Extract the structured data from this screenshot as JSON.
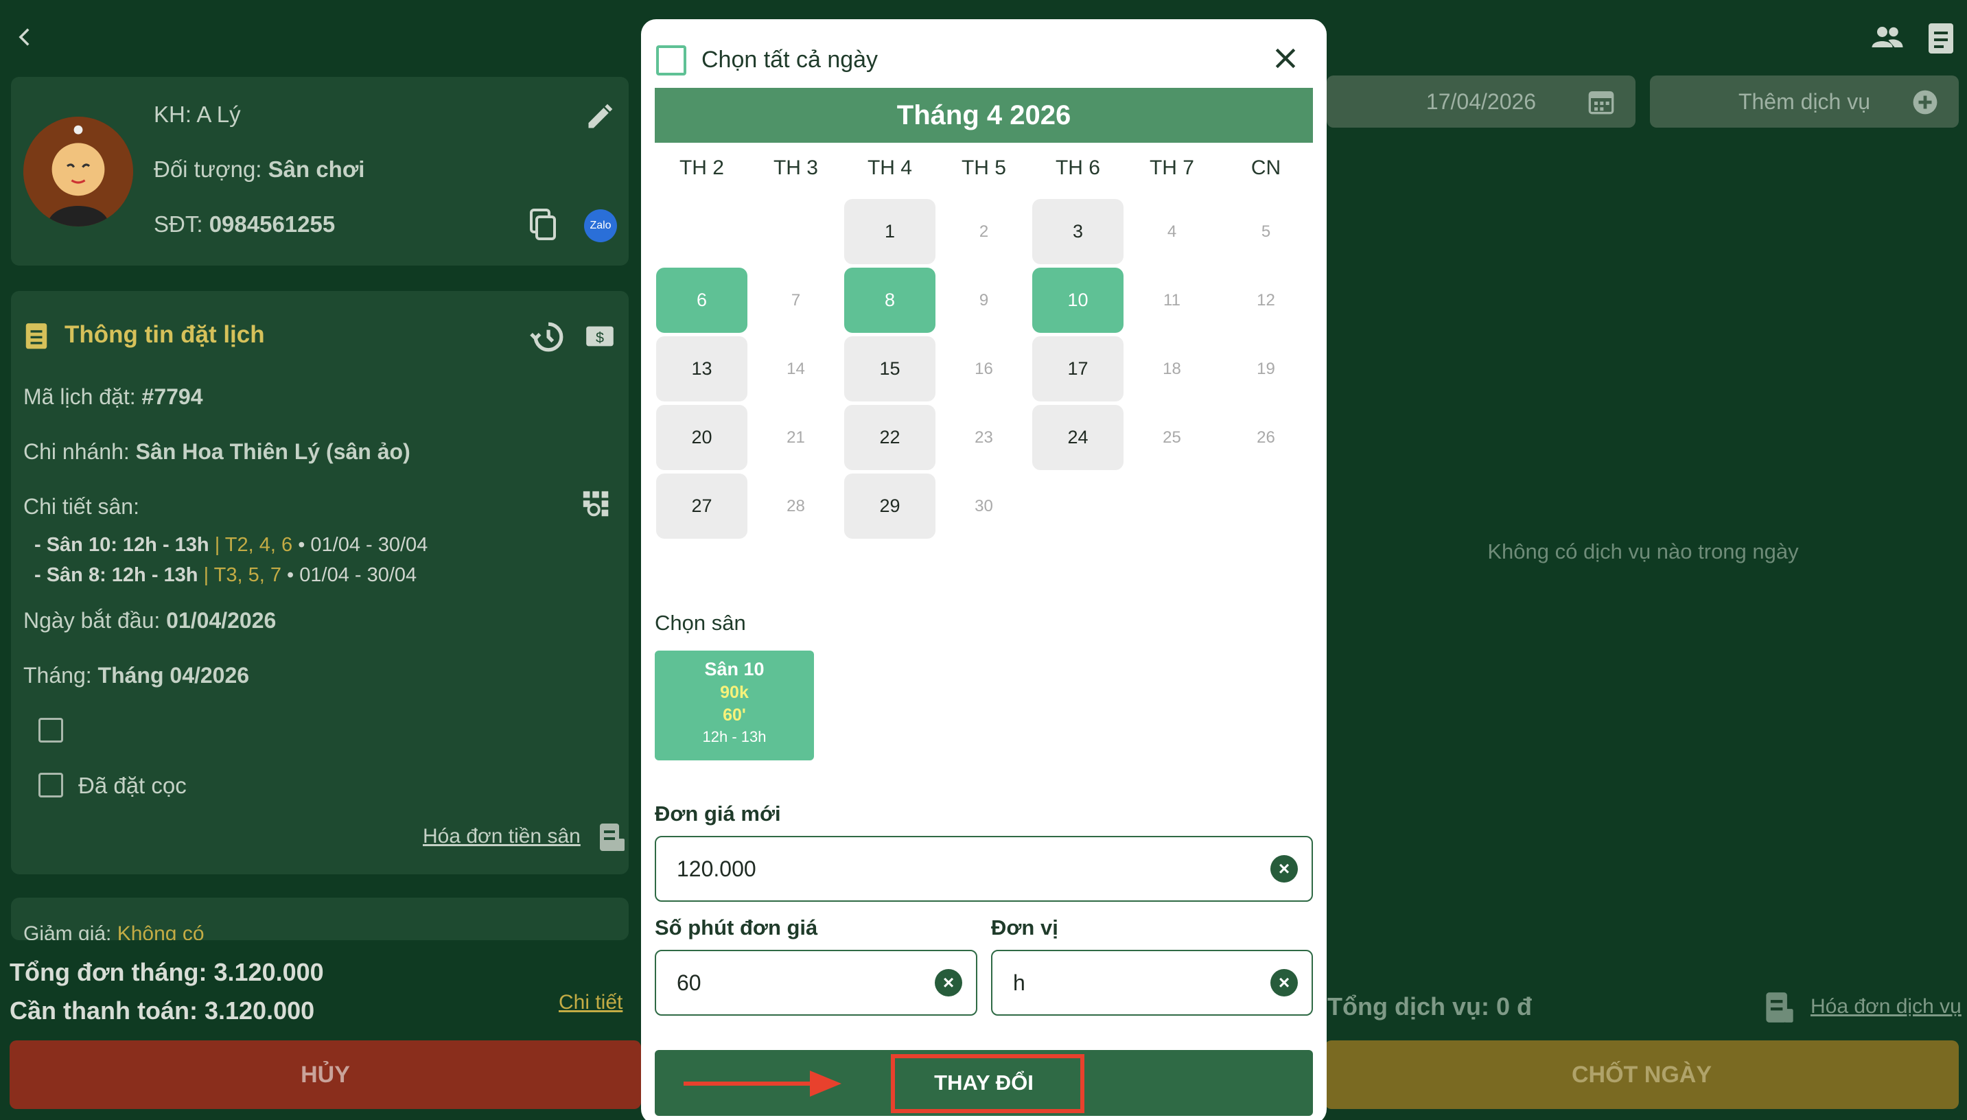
{
  "header": {
    "back_icon": "chevron-left-icon",
    "users_icon": "users-icon",
    "notes_icon": "clipboard-icon"
  },
  "customer": {
    "name_label": "KH:",
    "name_value": "A Lý",
    "target_label": "Đối tượng:",
    "target_value": "Sân chơi",
    "phone_label": "SĐT:",
    "phone_value": "0984561255",
    "zalo_label": "Zalo"
  },
  "booking": {
    "title": "Thông tin đặt lịch",
    "code_label": "Mã lịch đặt:",
    "code_value": "#7794",
    "branch_label": "Chi nhánh:",
    "branch_value": "Sân Hoa Thiên Lý (sân ảo)",
    "detail_label": "Chi tiết sân:",
    "detail_1_name": "- Sân 10: 12h - 13h",
    "detail_1_days": "| T2, 4, 6",
    "detail_1_range": "• 01/04 - 30/04",
    "detail_2_name": "- Sân 8: 12h - 13h",
    "detail_2_days": "| T3, 5, 7",
    "detail_2_range": "• 01/04 - 30/04",
    "start_label": "Ngày bắt đầu:",
    "start_value": "01/04/2026",
    "month_label": "Tháng:",
    "month_value": "Tháng 04/2026",
    "deposit_label": "Đã đặt cọc",
    "invoice_link": "Hóa đơn tiền sân",
    "discount_label": "Giảm giá:",
    "discount_value": "Không có"
  },
  "totals": {
    "month_total": "Tổng đơn tháng: 3.120.000",
    "to_pay": "Cần thanh toán: 3.120.000",
    "detail_link": "Chi tiết",
    "cancel_button": "HỦY"
  },
  "right_panel": {
    "date_value": "17/04/2026",
    "add_service": "Thêm dịch vụ",
    "empty_text": "Không có dịch vụ nào trong ngày",
    "service_total": "Tổng dịch vụ: 0 đ",
    "service_invoice": "Hóa đơn dịch vụ",
    "close_day_button": "CHỐT NGÀY"
  },
  "modal": {
    "select_all": "Chọn tất cả ngày",
    "month_title": "Tháng 4 2026",
    "weekdays": [
      "TH 2",
      "TH 3",
      "TH 4",
      "TH 5",
      "TH 6",
      "TH 7",
      "CN"
    ],
    "days": [
      "1",
      "2",
      "3",
      "4",
      "5",
      "6",
      "7",
      "8",
      "9",
      "10",
      "11",
      "12",
      "13",
      "14",
      "15",
      "16",
      "17",
      "18",
      "19",
      "20",
      "21",
      "22",
      "23",
      "24",
      "25",
      "26",
      "27",
      "28",
      "29",
      "30"
    ],
    "selected_days": [
      "6",
      "8",
      "10"
    ],
    "court_section": "Chọn sân",
    "court": {
      "name": "Sân 10",
      "price": "90k",
      "minutes": "60'",
      "time": "12h - 13h"
    },
    "price_label": "Đơn giá mới",
    "price_value": "120.000",
    "minutes_label": "Số phút đơn giá",
    "minutes_value": "60",
    "unit_label": "Đơn vị",
    "unit_value": "h",
    "change_button": "THAY ĐỔI"
  },
  "colors": {
    "accent_green": "#4f9368",
    "selected_day": "#5fc195",
    "dark_green": "#275c3b",
    "highlight_red": "#e8412d"
  }
}
